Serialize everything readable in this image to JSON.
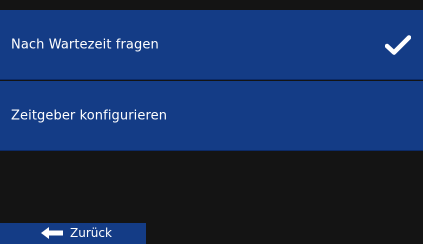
{
  "menu": {
    "items": [
      {
        "label": "Nach Wartezeit fragen",
        "checked": true,
        "icon": "checkmark-icon"
      },
      {
        "label": "Zeitgeber konfigurieren",
        "checked": false
      }
    ]
  },
  "footer": {
    "back_label": "Zurück",
    "back_icon": "arrow-left-icon"
  },
  "colors": {
    "background": "#141414",
    "item_background": "#143c86",
    "text": "#ffffff"
  }
}
